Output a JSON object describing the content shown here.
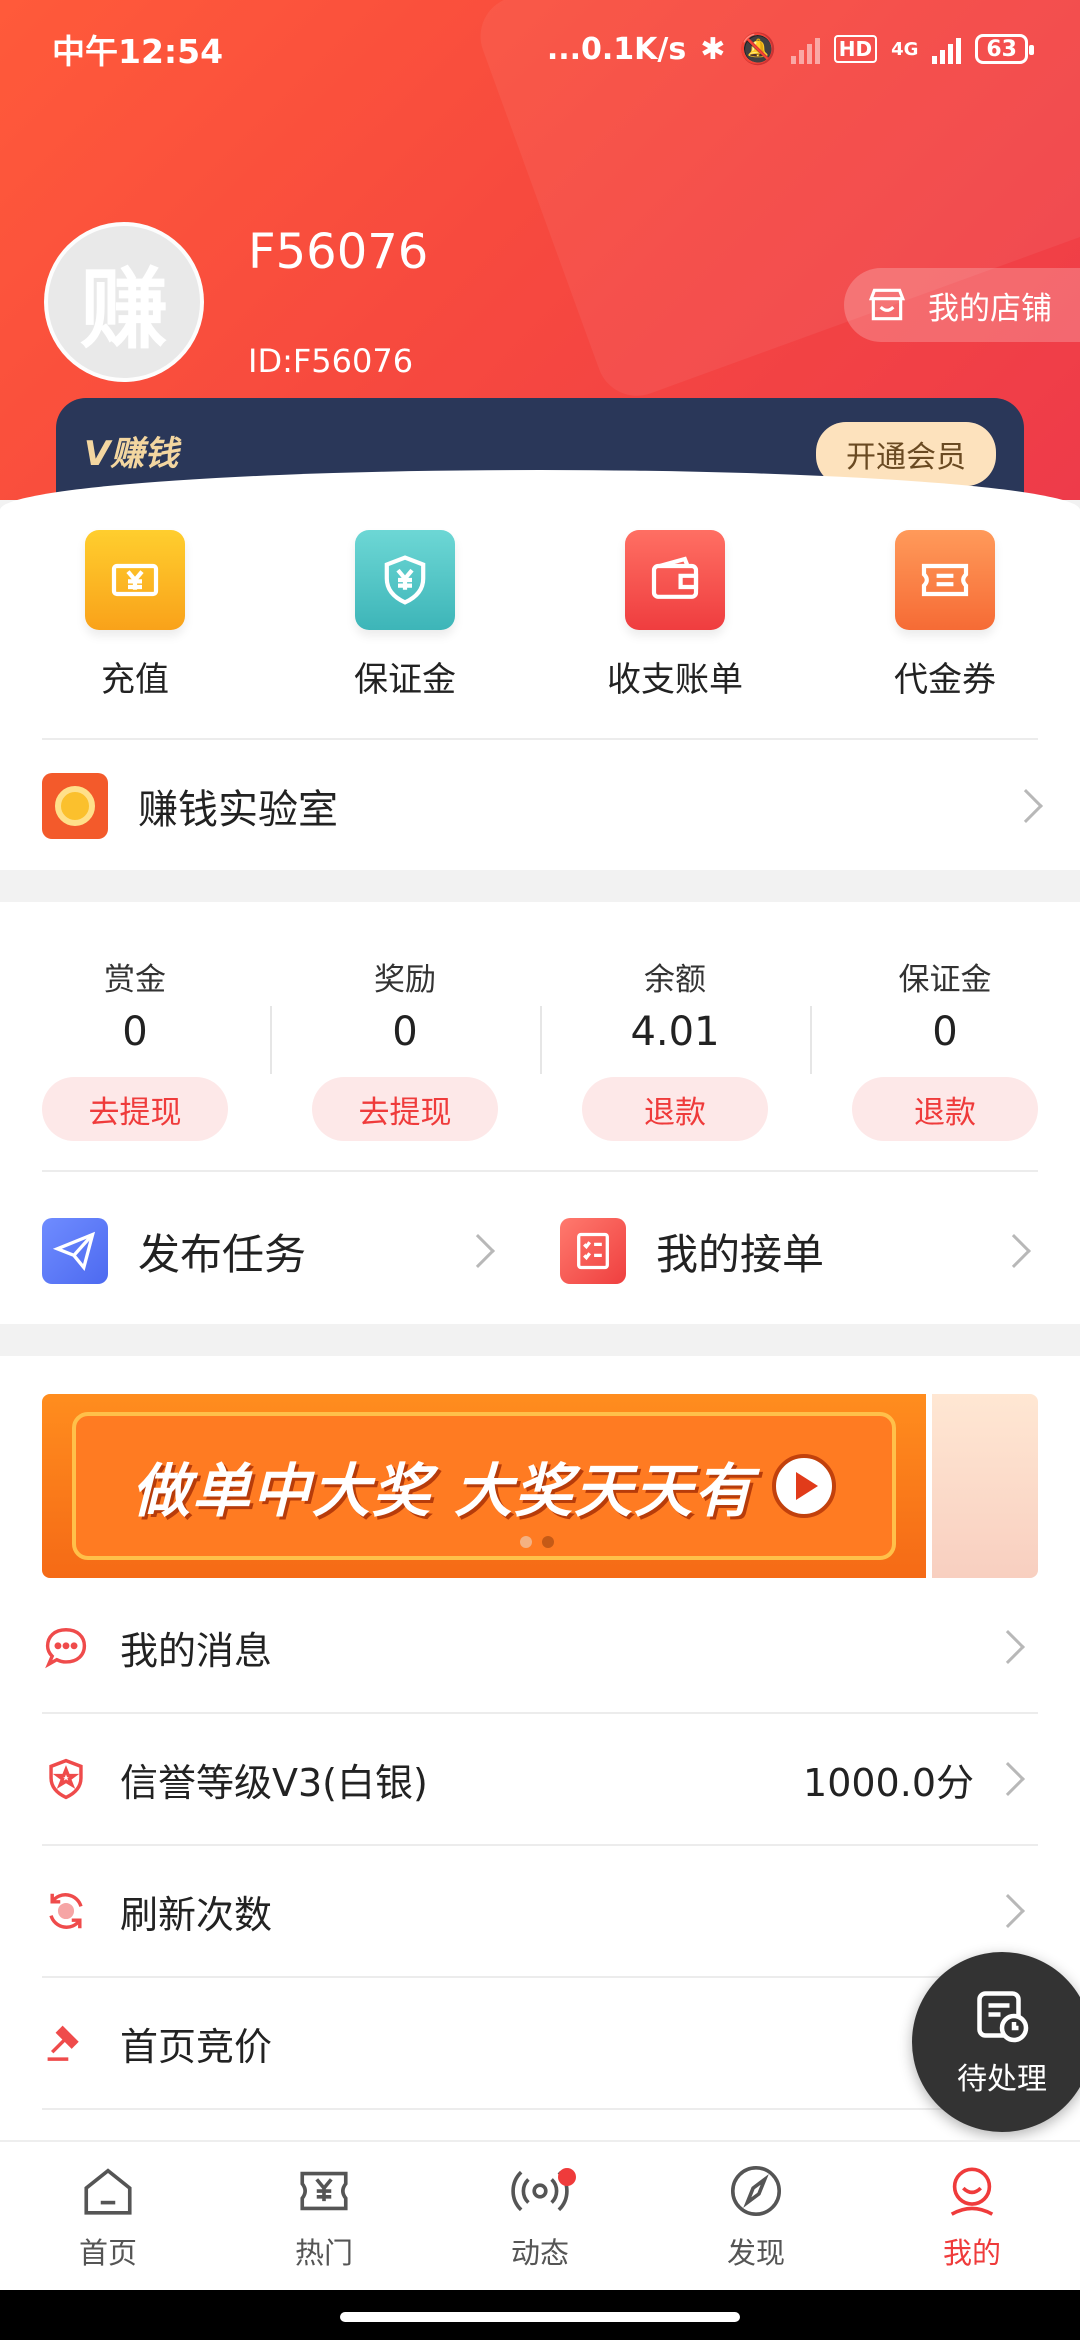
{
  "status_bar": {
    "time": "中午12:54",
    "net_speed": "...0.1K/s",
    "hd": "HD",
    "network": "4G",
    "battery": "63"
  },
  "profile": {
    "avatar_text": "赚",
    "username": "F56076",
    "user_id": "ID:F56076",
    "shop_label": "我的店铺"
  },
  "vip": {
    "logo_text": "V赚钱",
    "button_label": "开通会员"
  },
  "quick_actions": [
    {
      "label": "充值",
      "icon": "recharge-icon",
      "color": "#fbb31e"
    },
    {
      "label": "保证金",
      "icon": "deposit-shield-icon",
      "color": "#4ec1c4"
    },
    {
      "label": "收支账单",
      "icon": "wallet-icon",
      "color": "#f2524b"
    },
    {
      "label": "代金券",
      "icon": "coupon-icon",
      "color": "#fb7a42"
    }
  ],
  "lab": {
    "label": "赚钱实验室"
  },
  "stats": [
    {
      "title": "赏金",
      "value": "0",
      "button": "去提现"
    },
    {
      "title": "奖励",
      "value": "0",
      "button": "去提现"
    },
    {
      "title": "余额",
      "value": "4.01",
      "button": "退款"
    },
    {
      "title": "保证金",
      "value": "0",
      "button": "退款"
    }
  ],
  "publish": {
    "left_label": "发布任务",
    "right_label": "我的接单"
  },
  "banner": {
    "text": "做单中大奖 大奖天天有"
  },
  "list": [
    {
      "label": "我的消息",
      "value": ""
    },
    {
      "label": "信誉等级V3(白银)",
      "value": "1000.0分"
    },
    {
      "label": "刷新次数",
      "value": ""
    },
    {
      "label": "首页竞价",
      "value": ""
    }
  ],
  "pending": {
    "label": "待处理"
  },
  "tabs": [
    {
      "label": "首页"
    },
    {
      "label": "热门"
    },
    {
      "label": "动态"
    },
    {
      "label": "发现"
    },
    {
      "label": "我的"
    }
  ],
  "colors": {
    "accent": "#ef3b3b",
    "header": "#f74a3e",
    "vip_bar": "#2a3759"
  }
}
